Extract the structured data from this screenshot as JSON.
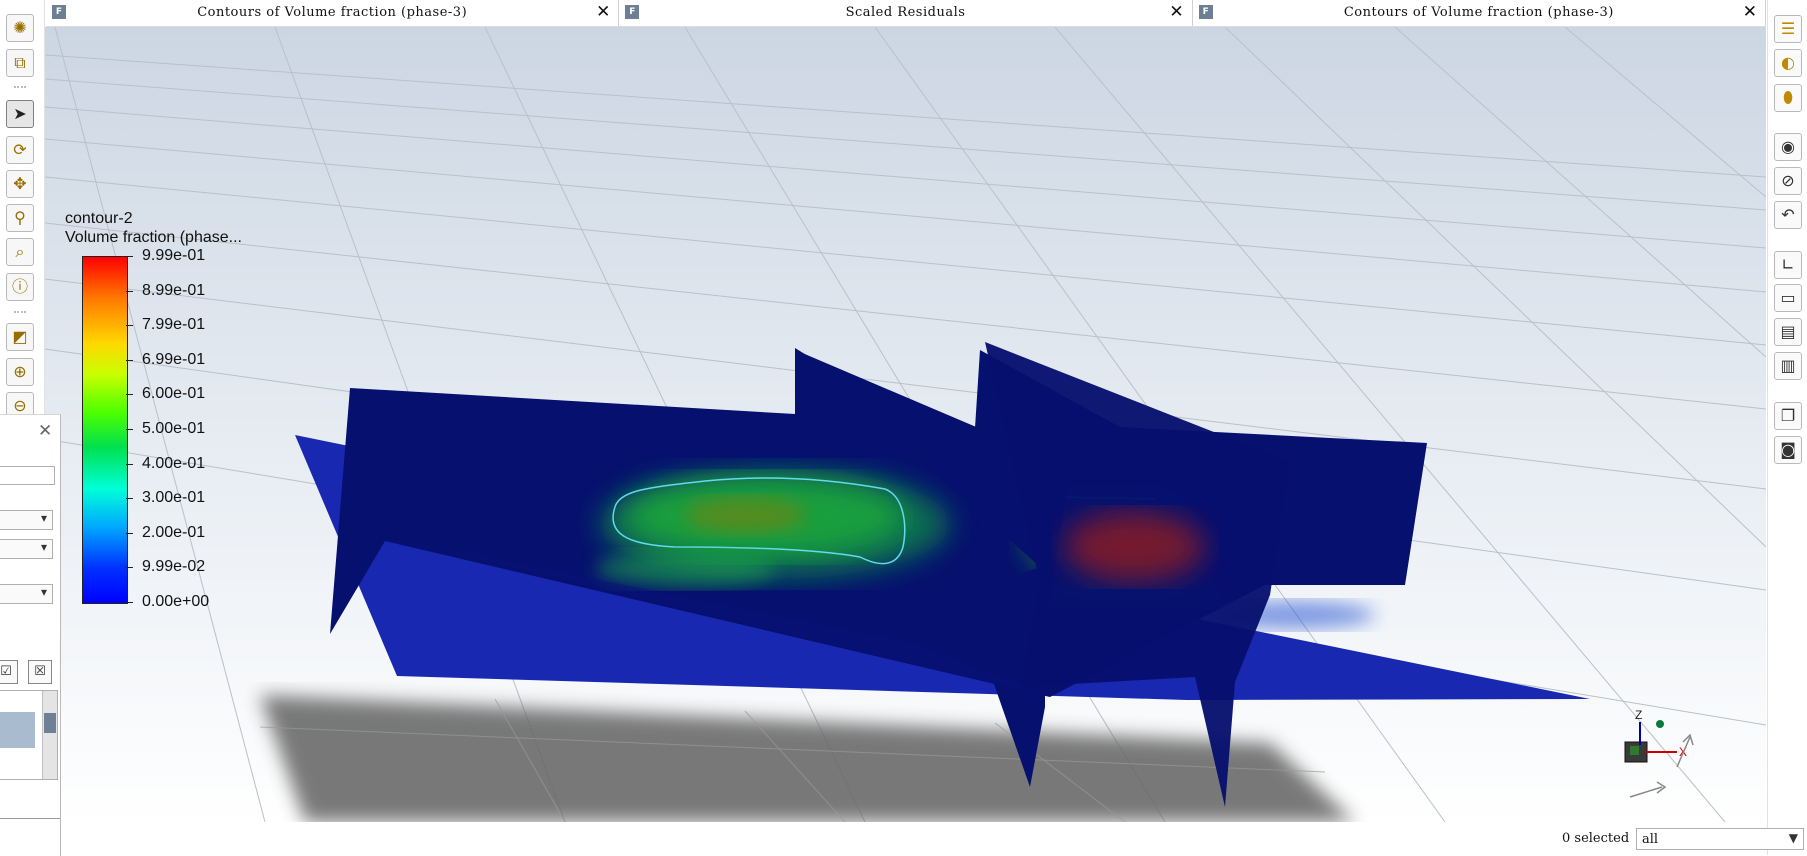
{
  "tabs": [
    {
      "icon": "F",
      "title": "Contours of Volume fraction (phase-3)",
      "close": "✕"
    },
    {
      "icon": "F",
      "title": "Scaled Residuals",
      "close": "✕"
    },
    {
      "icon": "F",
      "title": "Contours of Volume fraction (phase-3)",
      "close": "✕"
    }
  ],
  "legend": {
    "name": "contour-2",
    "variable": "Volume fraction (phase...",
    "levels": [
      "9.99e-01",
      "8.99e-01",
      "7.99e-01",
      "6.99e-01",
      "6.00e-01",
      "5.00e-01",
      "4.00e-01",
      "3.00e-01",
      "2.00e-01",
      "9.99e-02",
      "0.00e+00"
    ],
    "colormap": [
      "#ff0000",
      "#ff7a00",
      "#ffd800",
      "#c8ff00",
      "#4cff00",
      "#00e050",
      "#00ffd8",
      "#00a8ff",
      "#0030ff",
      "#0000ff"
    ]
  },
  "triad": {
    "z": "Z",
    "x": "X"
  },
  "status": {
    "selected": "0 selected",
    "filter_value": "all"
  },
  "side_panel": {
    "close": "✕"
  },
  "colors": {
    "background_top": "#ccd6e3",
    "background_bottom": "#ffffff",
    "planes": "#06106e",
    "floor_plane": "#1828b0",
    "shadow": "#6b6b6b"
  }
}
